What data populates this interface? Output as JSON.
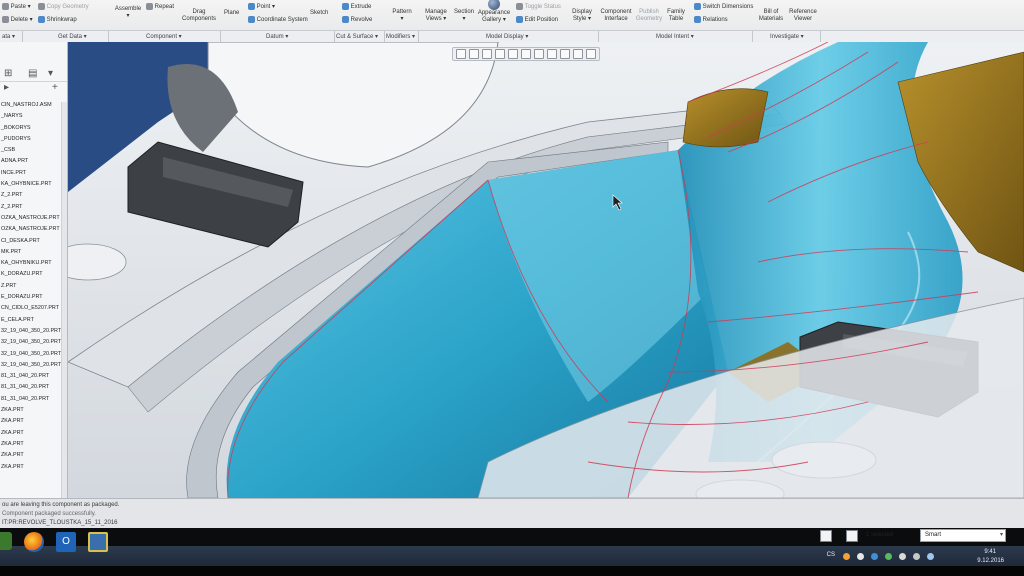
{
  "ribbon": {
    "paste": "Paste",
    "delete": "Delete",
    "copy_geometry": "Copy Geometry",
    "shrinkwrap": "Shrinkwrap",
    "assemble": "Assemble",
    "repeat": "Repeat",
    "drag_components": "Drag Components",
    "plane": "Plane",
    "point": "Point",
    "coordinate_system": "Coordinate System",
    "sketch": "Sketch",
    "extrude": "Extrude",
    "revolve": "Revolve",
    "pattern": "Pattern",
    "manage_views": "Manage Views",
    "section": "Section",
    "appearance_gallery": "Appearance Gallery",
    "toggle_status": "Toggle Status",
    "edit_position": "Edit Position",
    "display_style": "Display Style",
    "component_interface": "Component Interface",
    "publish_geometry": "Publish Geometry",
    "family_table": "Family Table",
    "switch_dimensions": "Switch Dimensions",
    "relations": "Relations",
    "bill_of_materials": "Bill of Materials",
    "reference_viewer": "Reference Viewer"
  },
  "groups": [
    "ata ▾",
    "Get Data ▾",
    "Component ▾",
    "Datum ▾",
    "Cut & Surface ▾",
    "Modifiers ▾",
    "Model Display ▾",
    "Model Intent ▾",
    "Investigate ▾"
  ],
  "tree": {
    "items": [
      "CIN_NASTROJ.ASM",
      "_NARYS",
      "_BOKORYS",
      "_PUDORYS",
      "_CSB",
      "ADNA.PRT",
      "INCE.PRT",
      "KA_OHYBNICE.PRT",
      "Z_2.PRT",
      "Z_2.PRT",
      "OZKA_NASTROJE.PRT",
      "OZKA_NASTROJE.PRT",
      "CI_DESKA.PRT",
      "MK.PRT",
      "KA_OHYBNIKU.PRT",
      "K_DORAZU.PRT",
      "Z.PRT",
      "E_DORAZU.PRT",
      "CN_CIDLO_E5207.PRT",
      "E_CELA.PRT",
      "32_19_040_350_20.PRT",
      "32_19_040_350_20.PRT",
      "32_19_040_350_20.PRT",
      "32_19_040_350_20.PRT",
      "81_31_040_20.PRT",
      "81_31_040_20.PRT",
      "81_31_040_20.PRT",
      "ZKA.PRT",
      "ZKA.PRT",
      "ZKA.PRT",
      "ZKA.PRT",
      "ZKA.PRT",
      "ZKA.PRT"
    ]
  },
  "messages": {
    "line1": "ou are leaving this component as packaged.",
    "line2": "Component packaged successfully.",
    "line3": "IT:PR:REVOLVE_TLOUSTKA_15_11_2016"
  },
  "status": {
    "selected": "1 selected",
    "filter_value": "Smart"
  },
  "taskbar": {
    "lang": "CS",
    "time": "9:41",
    "date": "9.12.2016"
  },
  "colors": {
    "surface": "#3fb1d6",
    "surface_dark": "#1f86aa",
    "edge_highlight": "#d03a55",
    "gold": "#9e7a1f",
    "block": "#44474b"
  }
}
